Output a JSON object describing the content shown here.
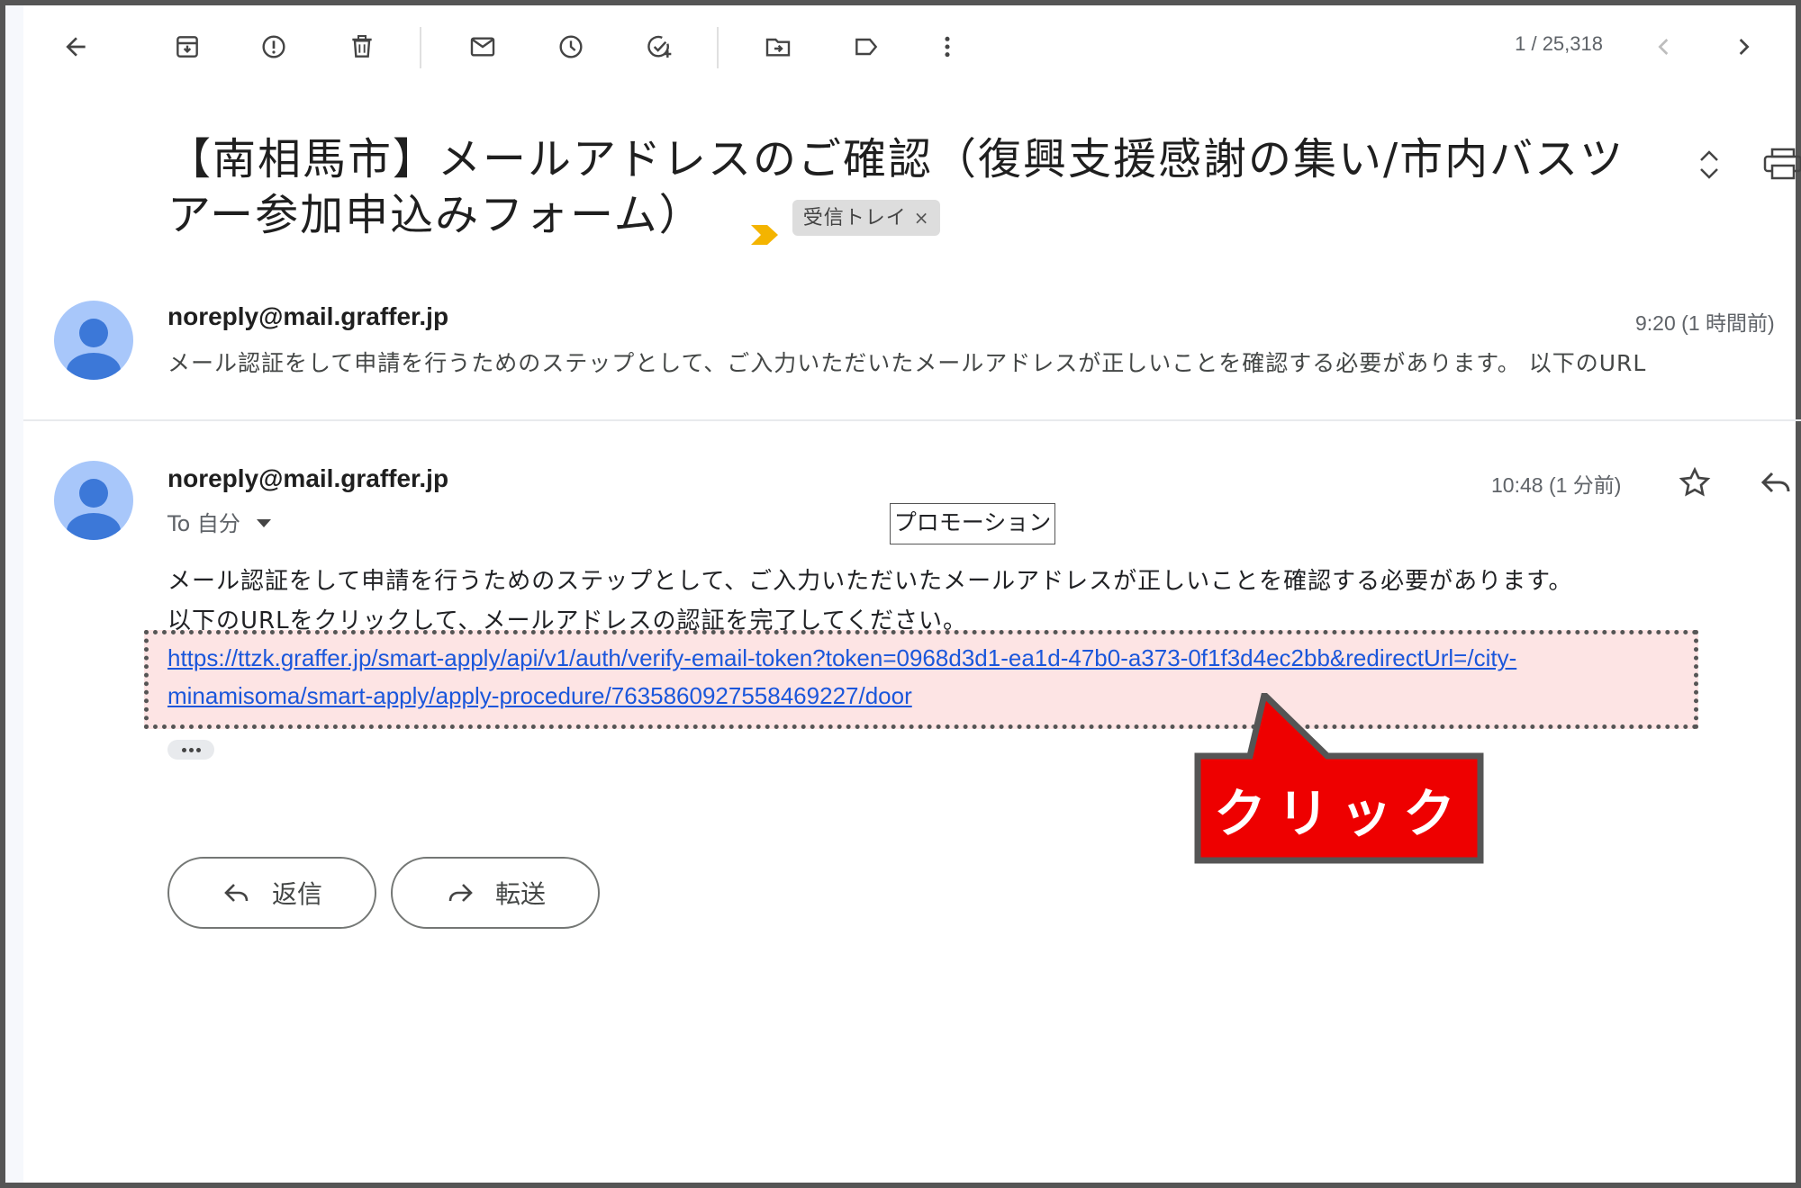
{
  "toolbar": {
    "icons": [
      "back-arrow-icon",
      "archive-icon",
      "report-spam-icon",
      "delete-icon",
      "mark-unread-icon",
      "snooze-icon",
      "add-task-icon",
      "move-to-icon",
      "label-icon",
      "more-vert-icon"
    ],
    "pager_text": "1 / 25,318"
  },
  "subject": {
    "text": "【南相馬市】メールアドレスのご確認（復興支援感謝の集い/市内バスツアー参加申込みフォーム）",
    "label_chip": "受信トレイ",
    "label_chip_close": "×",
    "importance_color": "#f4b400"
  },
  "messages": [
    {
      "sender": "noreply@mail.graffer.jp",
      "time": "9:20 (1 時間前)",
      "snippet": "メール認証をして申請を行うためのステップとして、ご入力いただいたメールアドレスが正しいことを確認する必要があります。 以下のURL"
    },
    {
      "sender": "noreply@mail.graffer.jp",
      "to": "To 自分",
      "time": "10:48 (1 分前)",
      "body_line1": "メール認証をして申請を行うためのステップとして、ご入力いただいたメールアドレスが正しいことを確認する必要があります。",
      "body_line2": "以下のURLをクリックして、メールアドレスの認証を完了してください。",
      "link": "https://ttzk.graffer.jp/smart-apply/api/v1/auth/verify-email-token?token=0968d3d1-ea1d-47b0-a373-0f1f3d4ec2bb&redirectUrl=/city-minamisoma/smart-apply/apply-procedure/7635860927558469227/door"
    }
  ],
  "promo_label": "プロモーション",
  "callout": {
    "text": "クリック",
    "color": "#ee0000"
  },
  "actions": {
    "reply": "返信",
    "forward": "転送"
  },
  "colors": {
    "link": "#1a56db",
    "highlight_bg": "#fde4e4",
    "avatar_bg": "#a8c7fa",
    "avatar_fg": "#3c78d8"
  }
}
